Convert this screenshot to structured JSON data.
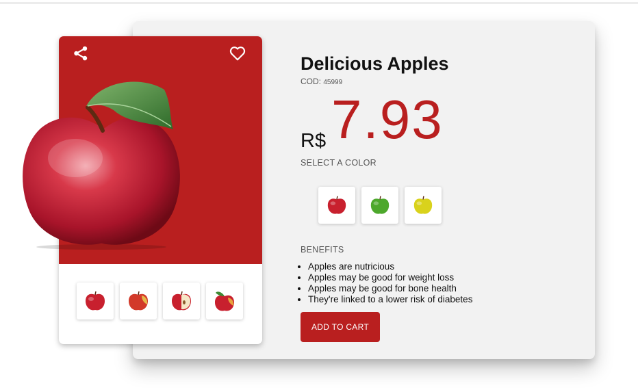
{
  "product": {
    "title": "Delicious Apples",
    "code_label": "COD:",
    "code": "45999",
    "currency": "R$",
    "price": "7.93"
  },
  "gallery": {
    "thumbnails": [
      "red-apple",
      "red-yellow-apple",
      "sliced-apple",
      "apple-with-leaf"
    ]
  },
  "colors": {
    "label": "SELECT A COLOR",
    "options": [
      "red",
      "green",
      "yellow"
    ]
  },
  "benefits": {
    "label": "BENEFITS",
    "items": [
      "Apples are nutricious",
      "Apples may be good for weight loss",
      "Apples may be good for bone health",
      "They're linked to a lower risk of diabetes"
    ]
  },
  "actions": {
    "add_to_cart": "ADD TO CART",
    "share_icon": "share-icon",
    "favorite_icon": "heart-icon"
  },
  "theme": {
    "accent": "#b91f1f",
    "card_bg": "#f2f2f2"
  }
}
